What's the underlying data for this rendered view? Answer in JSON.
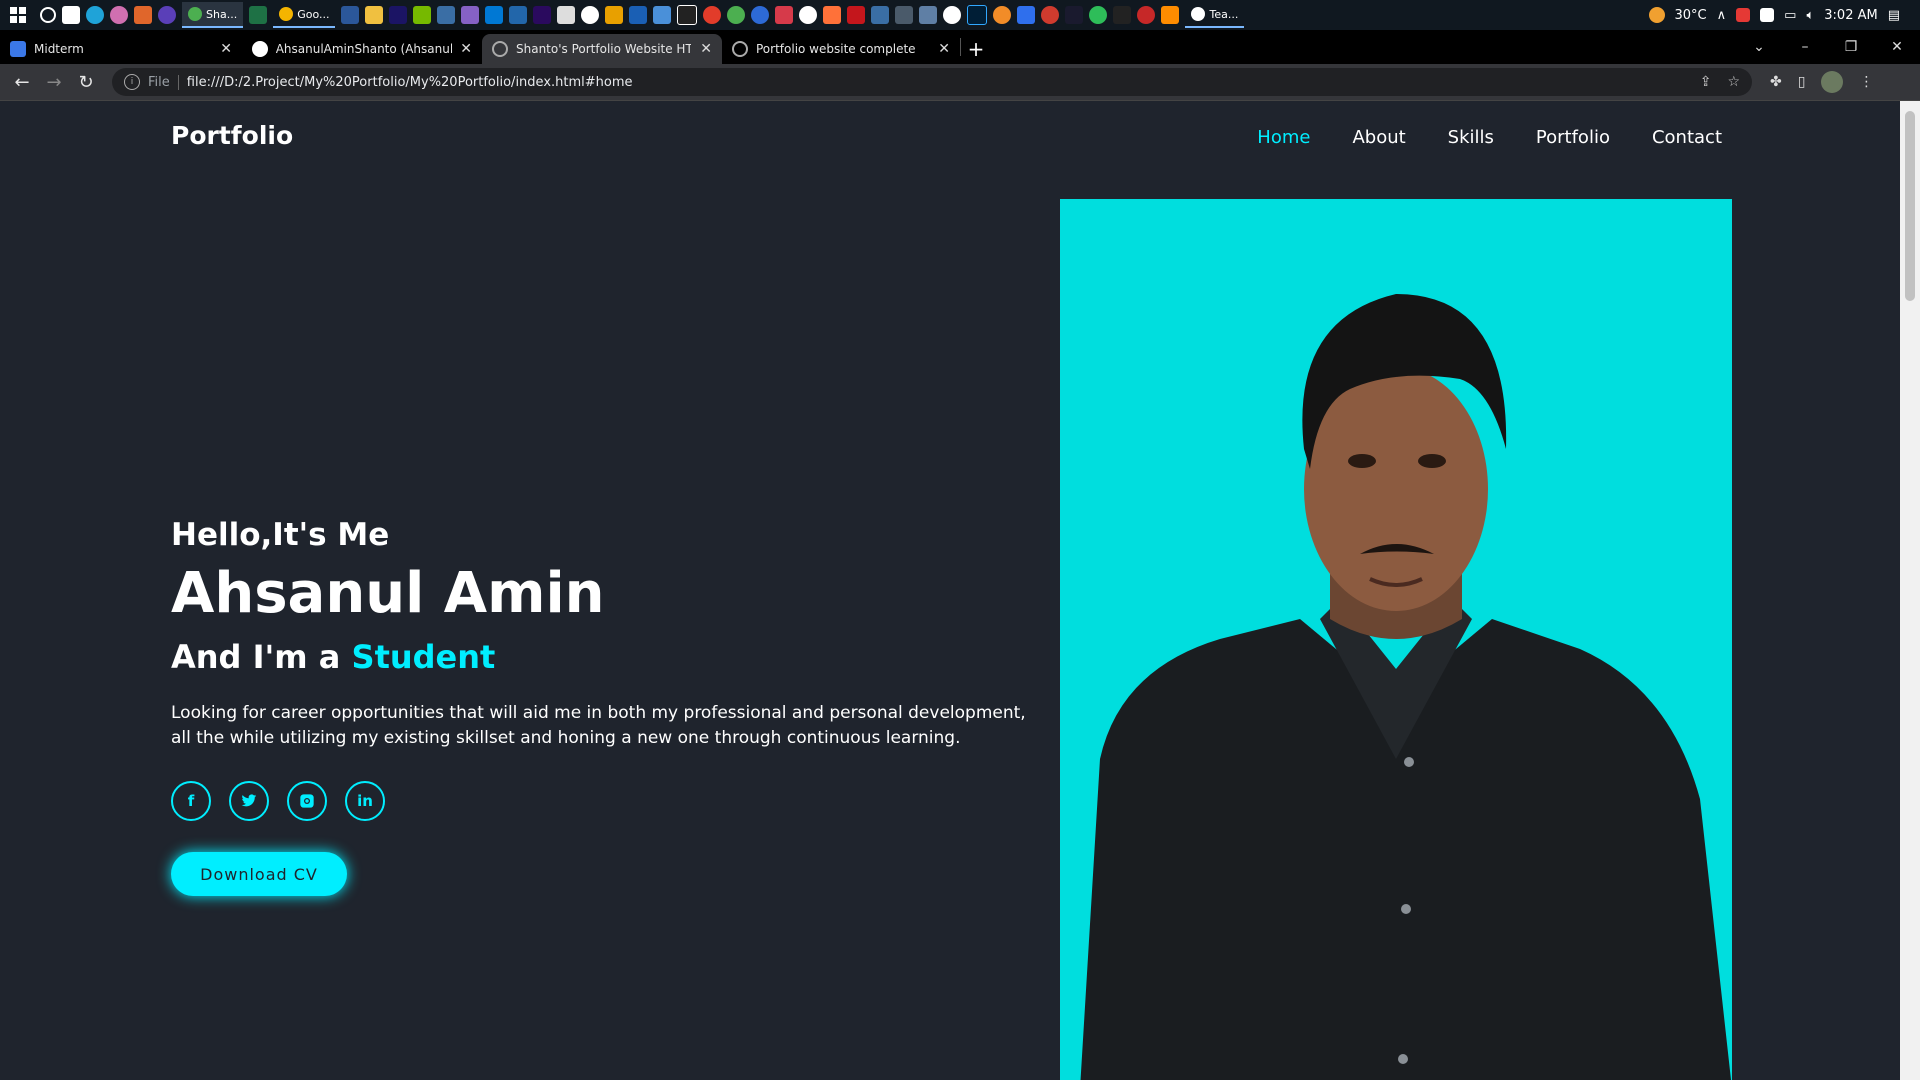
{
  "taskbar": {
    "task_label": "Sha...",
    "task2_label": "Goo...",
    "task3_label": "Tea...",
    "temperature": "30°C",
    "time": "3:02 AM"
  },
  "tabs": [
    {
      "label": "Midterm"
    },
    {
      "label": "AhsanulAminShanto (Ahsanul Am"
    },
    {
      "label": "Shanto's Portfolio Website HTML"
    },
    {
      "label": "Portfolio website complete"
    }
  ],
  "address": {
    "scheme_label": "File",
    "url": "file:///D:/2.Project/My%20Portfolio/My%20Portfolio/index.html#home"
  },
  "site": {
    "logo": "Portfolio",
    "nav": [
      "Home",
      "About",
      "Skills",
      "Portfolio",
      "Contact"
    ],
    "greeting": "Hello,It's Me",
    "name": "Ahsanul Amin",
    "role_prefix": "And I'm a ",
    "role_highlight": "Student",
    "description": "Looking for career opportunities that will aid me in both my professional and personal development, all the while utilizing my existing skillset and honing a new one through continuous learning.",
    "socials": [
      "f",
      "in"
    ],
    "cv_button": "Download CV"
  },
  "colors": {
    "accent": "#00eeff",
    "background": "#1f242d",
    "photo_bg": "#00dede"
  }
}
